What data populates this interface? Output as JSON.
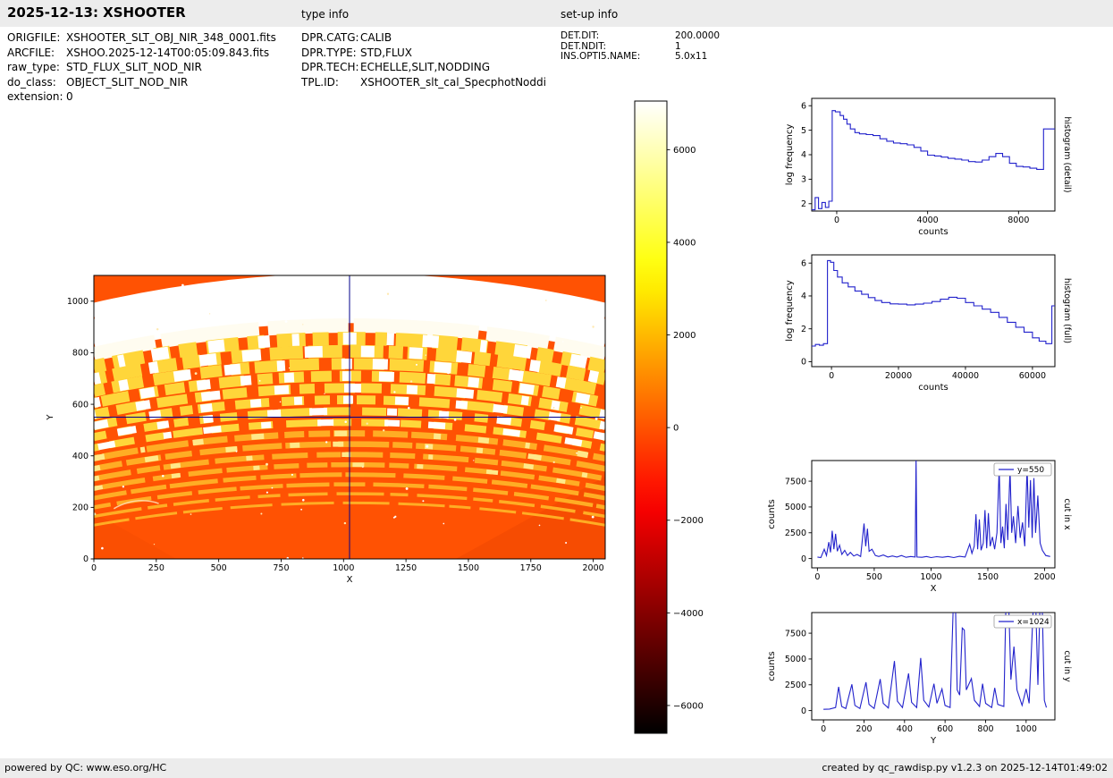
{
  "header": {
    "title": "2025-12-13: XSHOOTER",
    "type_info_label": "type info",
    "setup_info_label": "set-up info"
  },
  "file_info": [
    {
      "label": "ORIGFILE:",
      "value": "XSHOOTER_SLT_OBJ_NIR_348_0001.fits"
    },
    {
      "label": "ARCFILE:",
      "value": "XSHOO.2025-12-14T00:05:09.843.fits"
    },
    {
      "label": "raw_type:",
      "value": "STD_FLUX_SLIT_NOD_NIR"
    },
    {
      "label": "do_class:",
      "value": "OBJECT_SLIT_NOD_NIR"
    },
    {
      "label": "extension:",
      "value": "0"
    }
  ],
  "type_info": [
    {
      "label": "DPR.CATG:",
      "value": "CALIB"
    },
    {
      "label": "DPR.TYPE:",
      "value": "STD,FLUX"
    },
    {
      "label": "DPR.TECH:",
      "value": "ECHELLE,SLIT,NODDING"
    },
    {
      "label": "TPL.ID:",
      "value": "XSHOOTER_slt_cal_SpecphotNoddi"
    }
  ],
  "setup_info": [
    {
      "label": "DET.DIT:",
      "value": "200.0000"
    },
    {
      "label": "DET.NDIT:",
      "value": "1"
    },
    {
      "label": "INS.OPTI5.NAME:",
      "value": "5.0x11"
    }
  ],
  "footer": {
    "left": "powered by QC: www.eso.org/HC",
    "right": "created by qc_rawdisp.py v1.2.3 on 2025-12-14T01:49:02"
  },
  "colors": {
    "line_blue": "#2222cc",
    "crosshair_blue": "#00008b",
    "bar_gray": "#ececec",
    "image_background": "#ff5203"
  },
  "chart_data": [
    {
      "id": "main_image",
      "type": "heatmap",
      "xlabel": "X",
      "ylabel": "Y",
      "xlim": [
        0,
        2048
      ],
      "ylim": [
        0,
        1100
      ],
      "xticks": [
        0,
        250,
        500,
        750,
        1000,
        1250,
        1500,
        1750,
        2000
      ],
      "yticks": [
        0,
        200,
        400,
        600,
        800,
        1000
      ],
      "crosshair_x": 1024,
      "crosshair_y": 550,
      "colormap": "hot",
      "note": "XSHOOTER NIR raw echelle frame: ~20 upward-arching spectral orders; top orders solid white, middle orders broken into bright white/yellow blocks, lower orders thin orange-yellow arcs on bright orange background; blue crosshair at x=1024, y=550"
    },
    {
      "id": "colorbar",
      "type": "colorbar",
      "colormap": "hot",
      "ticks": [
        6000,
        4000,
        2000,
        0,
        -2000,
        -4000,
        -6000
      ],
      "range": [
        -6600,
        7050
      ]
    },
    {
      "id": "hist_detail",
      "type": "line",
      "style": "step",
      "title_right": "histogram (detail)",
      "xlabel": "counts",
      "ylabel": "log frequency",
      "xlim": [
        -1100,
        9600
      ],
      "ylim": [
        1.7,
        6.3
      ],
      "xticks": [
        0,
        4000,
        8000
      ],
      "yticks": [
        2,
        3,
        4,
        5,
        6
      ],
      "x": [
        -1100,
        -950,
        -800,
        -650,
        -500,
        -350,
        -200,
        -60,
        150,
        300,
        450,
        600,
        800,
        1000,
        1300,
        1600,
        1900,
        2200,
        2500,
        2800,
        3100,
        3400,
        3700,
        4000,
        4300,
        4600,
        4900,
        5200,
        5500,
        5800,
        6100,
        6400,
        6700,
        7000,
        7300,
        7600,
        7900,
        8200,
        8500,
        8800,
        9100,
        9600
      ],
      "y": [
        1.75,
        2.25,
        1.8,
        2.05,
        1.85,
        2.1,
        5.8,
        5.75,
        5.6,
        5.45,
        5.25,
        5.05,
        4.9,
        4.85,
        4.82,
        4.78,
        4.65,
        4.55,
        4.48,
        4.45,
        4.4,
        4.3,
        4.15,
        3.98,
        3.95,
        3.9,
        3.85,
        3.82,
        3.78,
        3.72,
        3.7,
        3.78,
        3.92,
        4.05,
        3.92,
        3.65,
        3.52,
        3.5,
        3.45,
        3.4,
        5.05,
        5.05
      ]
    },
    {
      "id": "hist_full",
      "type": "line",
      "style": "step",
      "title_right": "histogram (full)",
      "xlabel": "counts",
      "ylabel": "log frequency",
      "xlim": [
        -5900,
        66700
      ],
      "ylim": [
        -0.3,
        6.5
      ],
      "xticks": [
        0,
        20000,
        40000,
        60000
      ],
      "yticks": [
        0,
        2,
        4,
        6
      ],
      "x": [
        -5900,
        -4800,
        -3600,
        -2400,
        -1200,
        -300,
        700,
        1800,
        3200,
        5000,
        7000,
        9000,
        11000,
        13000,
        15000,
        17500,
        20000,
        22500,
        25000,
        27500,
        30000,
        32500,
        35000,
        37500,
        40000,
        42500,
        45000,
        47500,
        50000,
        52500,
        55000,
        57500,
        60000,
        62000,
        64000,
        65800,
        66700
      ],
      "y": [
        0.95,
        1.05,
        1.0,
        1.1,
        6.15,
        6.05,
        5.55,
        5.15,
        4.8,
        4.55,
        4.3,
        4.1,
        3.9,
        3.72,
        3.6,
        3.52,
        3.5,
        3.46,
        3.5,
        3.56,
        3.66,
        3.8,
        3.92,
        3.86,
        3.6,
        3.4,
        3.2,
        3.0,
        2.7,
        2.4,
        2.1,
        1.8,
        1.45,
        1.25,
        1.1,
        3.4,
        3.4
      ]
    },
    {
      "id": "cut_x",
      "type": "line",
      "style": "line",
      "legend": "y=550",
      "title_right": "cut in x",
      "xlabel": "X",
      "ylabel": "counts",
      "xlim": [
        -50,
        2090
      ],
      "ylim": [
        -900,
        9500
      ],
      "xticks": [
        0,
        500,
        1000,
        1500,
        2000
      ],
      "yticks": [
        0,
        2500,
        5000,
        7500
      ],
      "x": [
        0,
        30,
        60,
        80,
        100,
        115,
        130,
        145,
        160,
        175,
        195,
        215,
        240,
        265,
        290,
        320,
        350,
        380,
        410,
        425,
        440,
        455,
        480,
        510,
        540,
        580,
        620,
        660,
        700,
        740,
        780,
        820,
        860,
        868,
        876,
        920,
        960,
        1000,
        1050,
        1100,
        1150,
        1200,
        1250,
        1300,
        1340,
        1360,
        1380,
        1395,
        1410,
        1425,
        1440,
        1460,
        1475,
        1490,
        1505,
        1520,
        1540,
        1560,
        1580,
        1600,
        1615,
        1630,
        1645,
        1660,
        1675,
        1695,
        1710,
        1725,
        1745,
        1765,
        1785,
        1805,
        1825,
        1845,
        1860,
        1875,
        1890,
        1905,
        1920,
        1940,
        1960,
        1980,
        2010,
        2048
      ],
      "y": [
        150,
        100,
        900,
        300,
        1600,
        600,
        2700,
        900,
        2400,
        700,
        1300,
        400,
        800,
        300,
        600,
        250,
        400,
        200,
        3400,
        1200,
        2900,
        700,
        900,
        300,
        200,
        350,
        150,
        250,
        150,
        300,
        120,
        200,
        150,
        9800,
        150,
        120,
        200,
        100,
        180,
        120,
        200,
        100,
        220,
        150,
        1400,
        500,
        1200,
        4300,
        900,
        3800,
        800,
        1500,
        4700,
        1000,
        4400,
        1200,
        2100,
        900,
        2500,
        8800,
        1500,
        3100,
        1000,
        5300,
        1800,
        8700,
        2500,
        4100,
        1500,
        5100,
        2000,
        3500,
        1200,
        8900,
        3000,
        7600,
        2000,
        7800,
        2500,
        6100,
        1500,
        800,
        300,
        200
      ]
    },
    {
      "id": "cut_y",
      "type": "line",
      "style": "line",
      "legend": "x=1024",
      "title_right": "cut in y",
      "xlabel": "Y",
      "ylabel": "counts",
      "xlim": [
        -58,
        1142
      ],
      "ylim": [
        -900,
        9500
      ],
      "xticks": [
        0,
        200,
        400,
        600,
        800,
        1000
      ],
      "yticks": [
        0,
        2500,
        5000,
        7500
      ],
      "x": [
        0,
        30,
        60,
        75,
        90,
        110,
        140,
        155,
        180,
        210,
        225,
        250,
        280,
        295,
        320,
        350,
        365,
        390,
        420,
        435,
        460,
        480,
        495,
        520,
        545,
        560,
        585,
        600,
        625,
        640,
        652,
        660,
        672,
        685,
        695,
        705,
        730,
        745,
        770,
        785,
        800,
        830,
        845,
        860,
        890,
        900,
        915,
        925,
        940,
        955,
        980,
        1000,
        1015,
        1035,
        1048,
        1058,
        1068,
        1080,
        1090,
        1100
      ],
      "y": [
        120,
        150,
        300,
        2300,
        400,
        200,
        2550,
        500,
        200,
        2750,
        600,
        200,
        3050,
        700,
        250,
        4800,
        900,
        300,
        3600,
        800,
        300,
        5100,
        1000,
        350,
        2600,
        700,
        2100,
        500,
        300,
        9800,
        9800,
        2000,
        1500,
        8000,
        7800,
        2000,
        3100,
        1000,
        400,
        2600,
        700,
        300,
        2200,
        600,
        400,
        9800,
        9800,
        3000,
        6200,
        2000,
        500,
        2100,
        700,
        9800,
        9800,
        2500,
        9800,
        9800,
        1000,
        300
      ]
    }
  ]
}
